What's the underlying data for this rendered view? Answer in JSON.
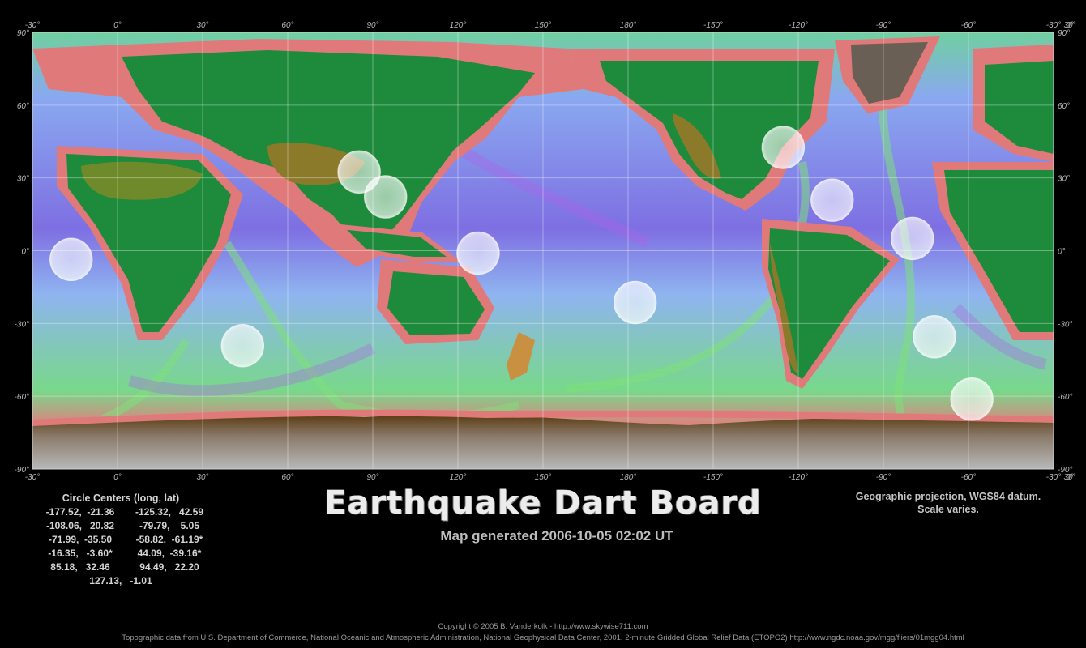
{
  "map": {
    "projection": "Geographic projection, WGS84 datum.",
    "scale_note": "Scale varies.",
    "top_longitude_labels": [
      "-30°",
      "0°",
      "30°",
      "60°",
      "90°",
      "120°",
      "150°",
      "180°",
      "-150°",
      "-120°",
      "-90°",
      "-60°",
      "-30°",
      "0°",
      "30°"
    ],
    "bottom_longitude_labels": [
      "-30°",
      "0°",
      "30°",
      "60°",
      "90°",
      "120°",
      "150°",
      "180°",
      "-150°",
      "-120°",
      "-90°",
      "-60°",
      "-30°",
      "0°",
      "30°"
    ],
    "latitude_labels": [
      "90°",
      "60°",
      "30°",
      "0°",
      "-30°",
      "-60°",
      "-90°"
    ],
    "circles": [
      {
        "lon": -177.52,
        "lat": -21.36
      },
      {
        "lon": -125.32,
        "lat": 42.59
      },
      {
        "lon": -108.06,
        "lat": 20.82
      },
      {
        "lon": -79.79,
        "lat": 5.05
      },
      {
        "lon": -71.99,
        "lat": -35.5
      },
      {
        "lon": -58.82,
        "lat": -61.19
      },
      {
        "lon": -16.35,
        "lat": -3.6
      },
      {
        "lon": 44.09,
        "lat": -39.16
      },
      {
        "lon": 85.18,
        "lat": 32.46
      },
      {
        "lon": 94.49,
        "lat": 22.2
      },
      {
        "lon": 127.13,
        "lat": -1.01
      }
    ],
    "colors": {
      "ocean_deep": "#7b6fe0",
      "ocean_mid": "#8fb0f0",
      "ridge": "#7ee07a",
      "shelf": "#e07a7a",
      "land_low": "#1e8a3c",
      "land_high": "#8a7a2a",
      "ice": "#bdbdbd",
      "circle": "#ffffff"
    }
  },
  "circle_centers": {
    "title": "Circle Centers (long, lat)",
    "rows": [
      [
        "-177.52,  -21.36",
        "-125.32,   42.59"
      ],
      [
        "-108.06,   20.82",
        "-79.79,    5.05"
      ],
      [
        "-71.99,  -35.50",
        "-58.82,  -61.19*"
      ],
      [
        "-16.35,   -3.60*",
        "44.09,  -39.16*"
      ],
      [
        "85.18,   32.46",
        "94.49,   22.20"
      ]
    ],
    "last": "127.13,   -1.01"
  },
  "title": "Earthquake Dart Board",
  "subtitle": "Map generated 2006-10-05 02:02 UT",
  "footer": {
    "copyright": "Copyright © 2005 B. Vanderkolk - http://www.skywise711.com",
    "source": "Topographic data from U.S. Department of Commerce, National Oceanic and Atmospheric Administration, National Geophysical Data Center, 2001. 2-minute Gridded Global Relief Data (ETOPO2) http://www.ngdc.noaa.gov/mgg/fliers/01mgg04.html"
  }
}
